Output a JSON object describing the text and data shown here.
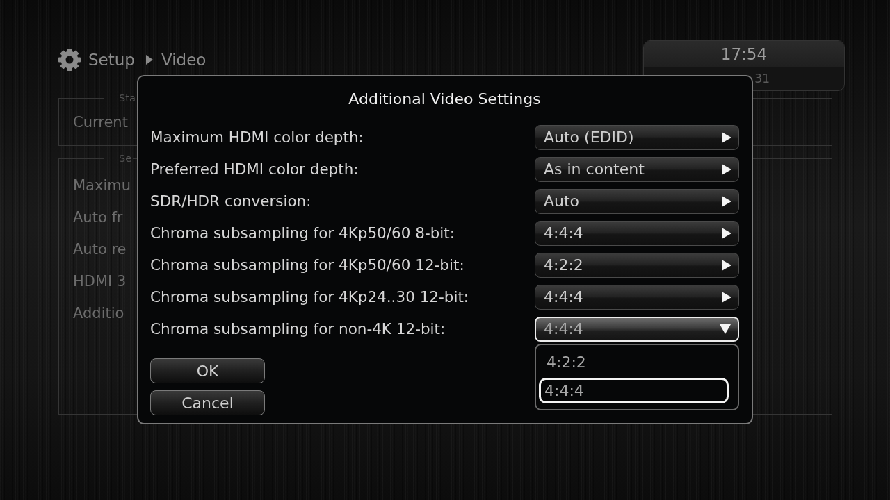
{
  "header": {
    "breadcrumb": [
      "Setup",
      "Video"
    ]
  },
  "clock": {
    "time": "17:54",
    "line_2": "31"
  },
  "background_panel": {
    "groups": [
      {
        "legend": "Sta",
        "items": [
          "Current"
        ]
      },
      {
        "legend": "Se",
        "items": [
          "Maximu",
          "Auto fr",
          "Auto re",
          "HDMI 3",
          "Additio"
        ]
      }
    ]
  },
  "dialog": {
    "title": "Additional Video Settings",
    "settings": [
      {
        "label": "Maximum HDMI color depth:",
        "value": "Auto (EDID)",
        "expanded": false
      },
      {
        "label": "Preferred HDMI color depth:",
        "value": "As in content",
        "expanded": false
      },
      {
        "label": "SDR/HDR conversion:",
        "value": "Auto",
        "expanded": false
      },
      {
        "label": "Chroma subsampling for 4Kp50/60 8-bit:",
        "value": "4:4:4",
        "expanded": false
      },
      {
        "label": "Chroma subsampling for 4Kp50/60 12-bit:",
        "value": "4:2:2",
        "expanded": false
      },
      {
        "label": "Chroma subsampling for 4Kp24..30 12-bit:",
        "value": "4:4:4",
        "expanded": false
      },
      {
        "label": "Chroma subsampling for non-4K 12-bit:",
        "value": "4:4:4",
        "expanded": true,
        "options": [
          {
            "label": "4:2:2",
            "selected": false
          },
          {
            "label": "4:4:4",
            "selected": true
          }
        ]
      }
    ],
    "buttons": [
      "OK",
      "Cancel"
    ]
  }
}
